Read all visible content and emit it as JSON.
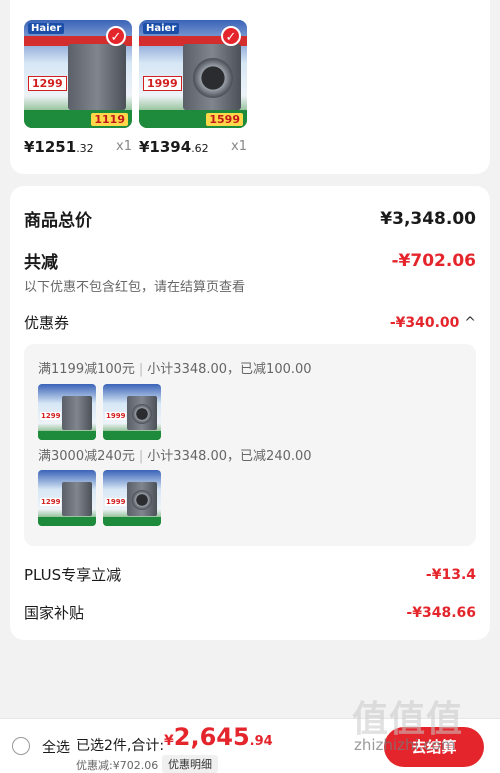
{
  "products": [
    {
      "brand": "Haier",
      "tag_price": "1299",
      "bottom_price": "1119",
      "price_int": "¥1251",
      "price_dec": ".32",
      "qty": "x1"
    },
    {
      "brand": "Haier",
      "tag_price": "1999",
      "bottom_price": "1599",
      "price_int": "¥1394",
      "price_dec": ".62",
      "qty": "x1"
    }
  ],
  "summary": {
    "total_label": "商品总价",
    "total_value": "¥3,348.00",
    "reduce_label": "共减",
    "reduce_value": "-¥702.06",
    "reduce_note": "以下优惠不包含红包，请在结算页查看",
    "coupon_label": "优惠券",
    "coupon_value": "-¥340.00",
    "coupon_chevron": "^",
    "coupons": [
      {
        "rule": "满1199减100元",
        "subtotal": "小计3348.00，已减100.00"
      },
      {
        "rule": "满3000减240元",
        "subtotal": "小计3348.00，已减240.00"
      }
    ],
    "plus_label": "PLUS专享立减",
    "plus_value": "-¥13.4",
    "subsidy_label": "国家补贴",
    "subsidy_value": "-¥348.66"
  },
  "bottom": {
    "select_all": "全选",
    "selected": "已选2件,合计:",
    "total_currency": "¥",
    "total_int": "2,645",
    "total_dec": ".94",
    "discount": "优惠减:¥702.06",
    "detail": "优惠明细",
    "checkout": "去结算"
  },
  "watermark": {
    "text": "值值值",
    "url": "zhizhizhi.com"
  },
  "colors": {
    "accent": "#e4262c",
    "background": "#f2f2f2"
  }
}
